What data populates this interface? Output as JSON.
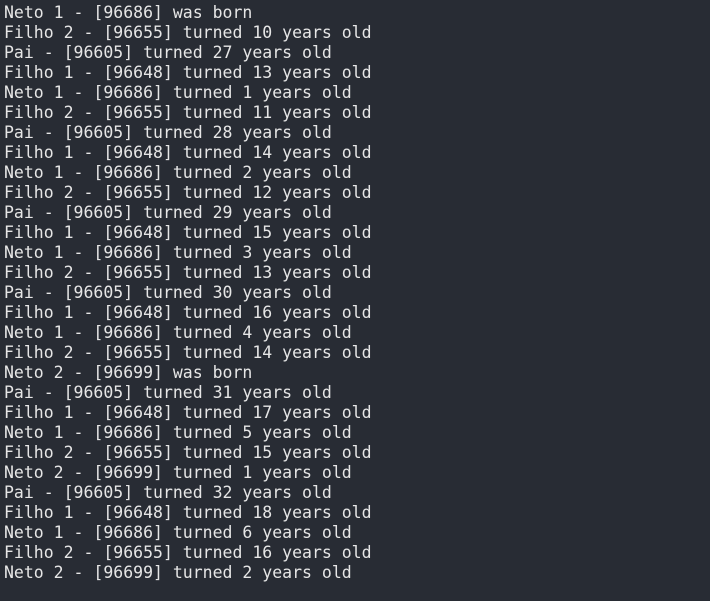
{
  "terminal": {
    "lines": [
      "Neto 1 - [96686] was born",
      "Filho 2 - [96655] turned 10 years old",
      "Pai - [96605] turned 27 years old",
      "Filho 1 - [96648] turned 13 years old",
      "Neto 1 - [96686] turned 1 years old",
      "Filho 2 - [96655] turned 11 years old",
      "Pai - [96605] turned 28 years old",
      "Filho 1 - [96648] turned 14 years old",
      "Neto 1 - [96686] turned 2 years old",
      "Filho 2 - [96655] turned 12 years old",
      "Pai - [96605] turned 29 years old",
      "Filho 1 - [96648] turned 15 years old",
      "Neto 1 - [96686] turned 3 years old",
      "Filho 2 - [96655] turned 13 years old",
      "Pai - [96605] turned 30 years old",
      "Filho 1 - [96648] turned 16 years old",
      "Neto 1 - [96686] turned 4 years old",
      "Filho 2 - [96655] turned 14 years old",
      "Neto 2 - [96699] was born",
      "Pai - [96605] turned 31 years old",
      "Filho 1 - [96648] turned 17 years old",
      "Neto 1 - [96686] turned 5 years old",
      "Filho 2 - [96655] turned 15 years old",
      "Neto 2 - [96699] turned 1 years old",
      "Pai - [96605] turned 32 years old",
      "Filho 1 - [96648] turned 18 years old",
      "Neto 1 - [96686] turned 6 years old",
      "Filho 2 - [96655] turned 16 years old",
      "Neto 2 - [96699] turned 2 years old"
    ]
  }
}
